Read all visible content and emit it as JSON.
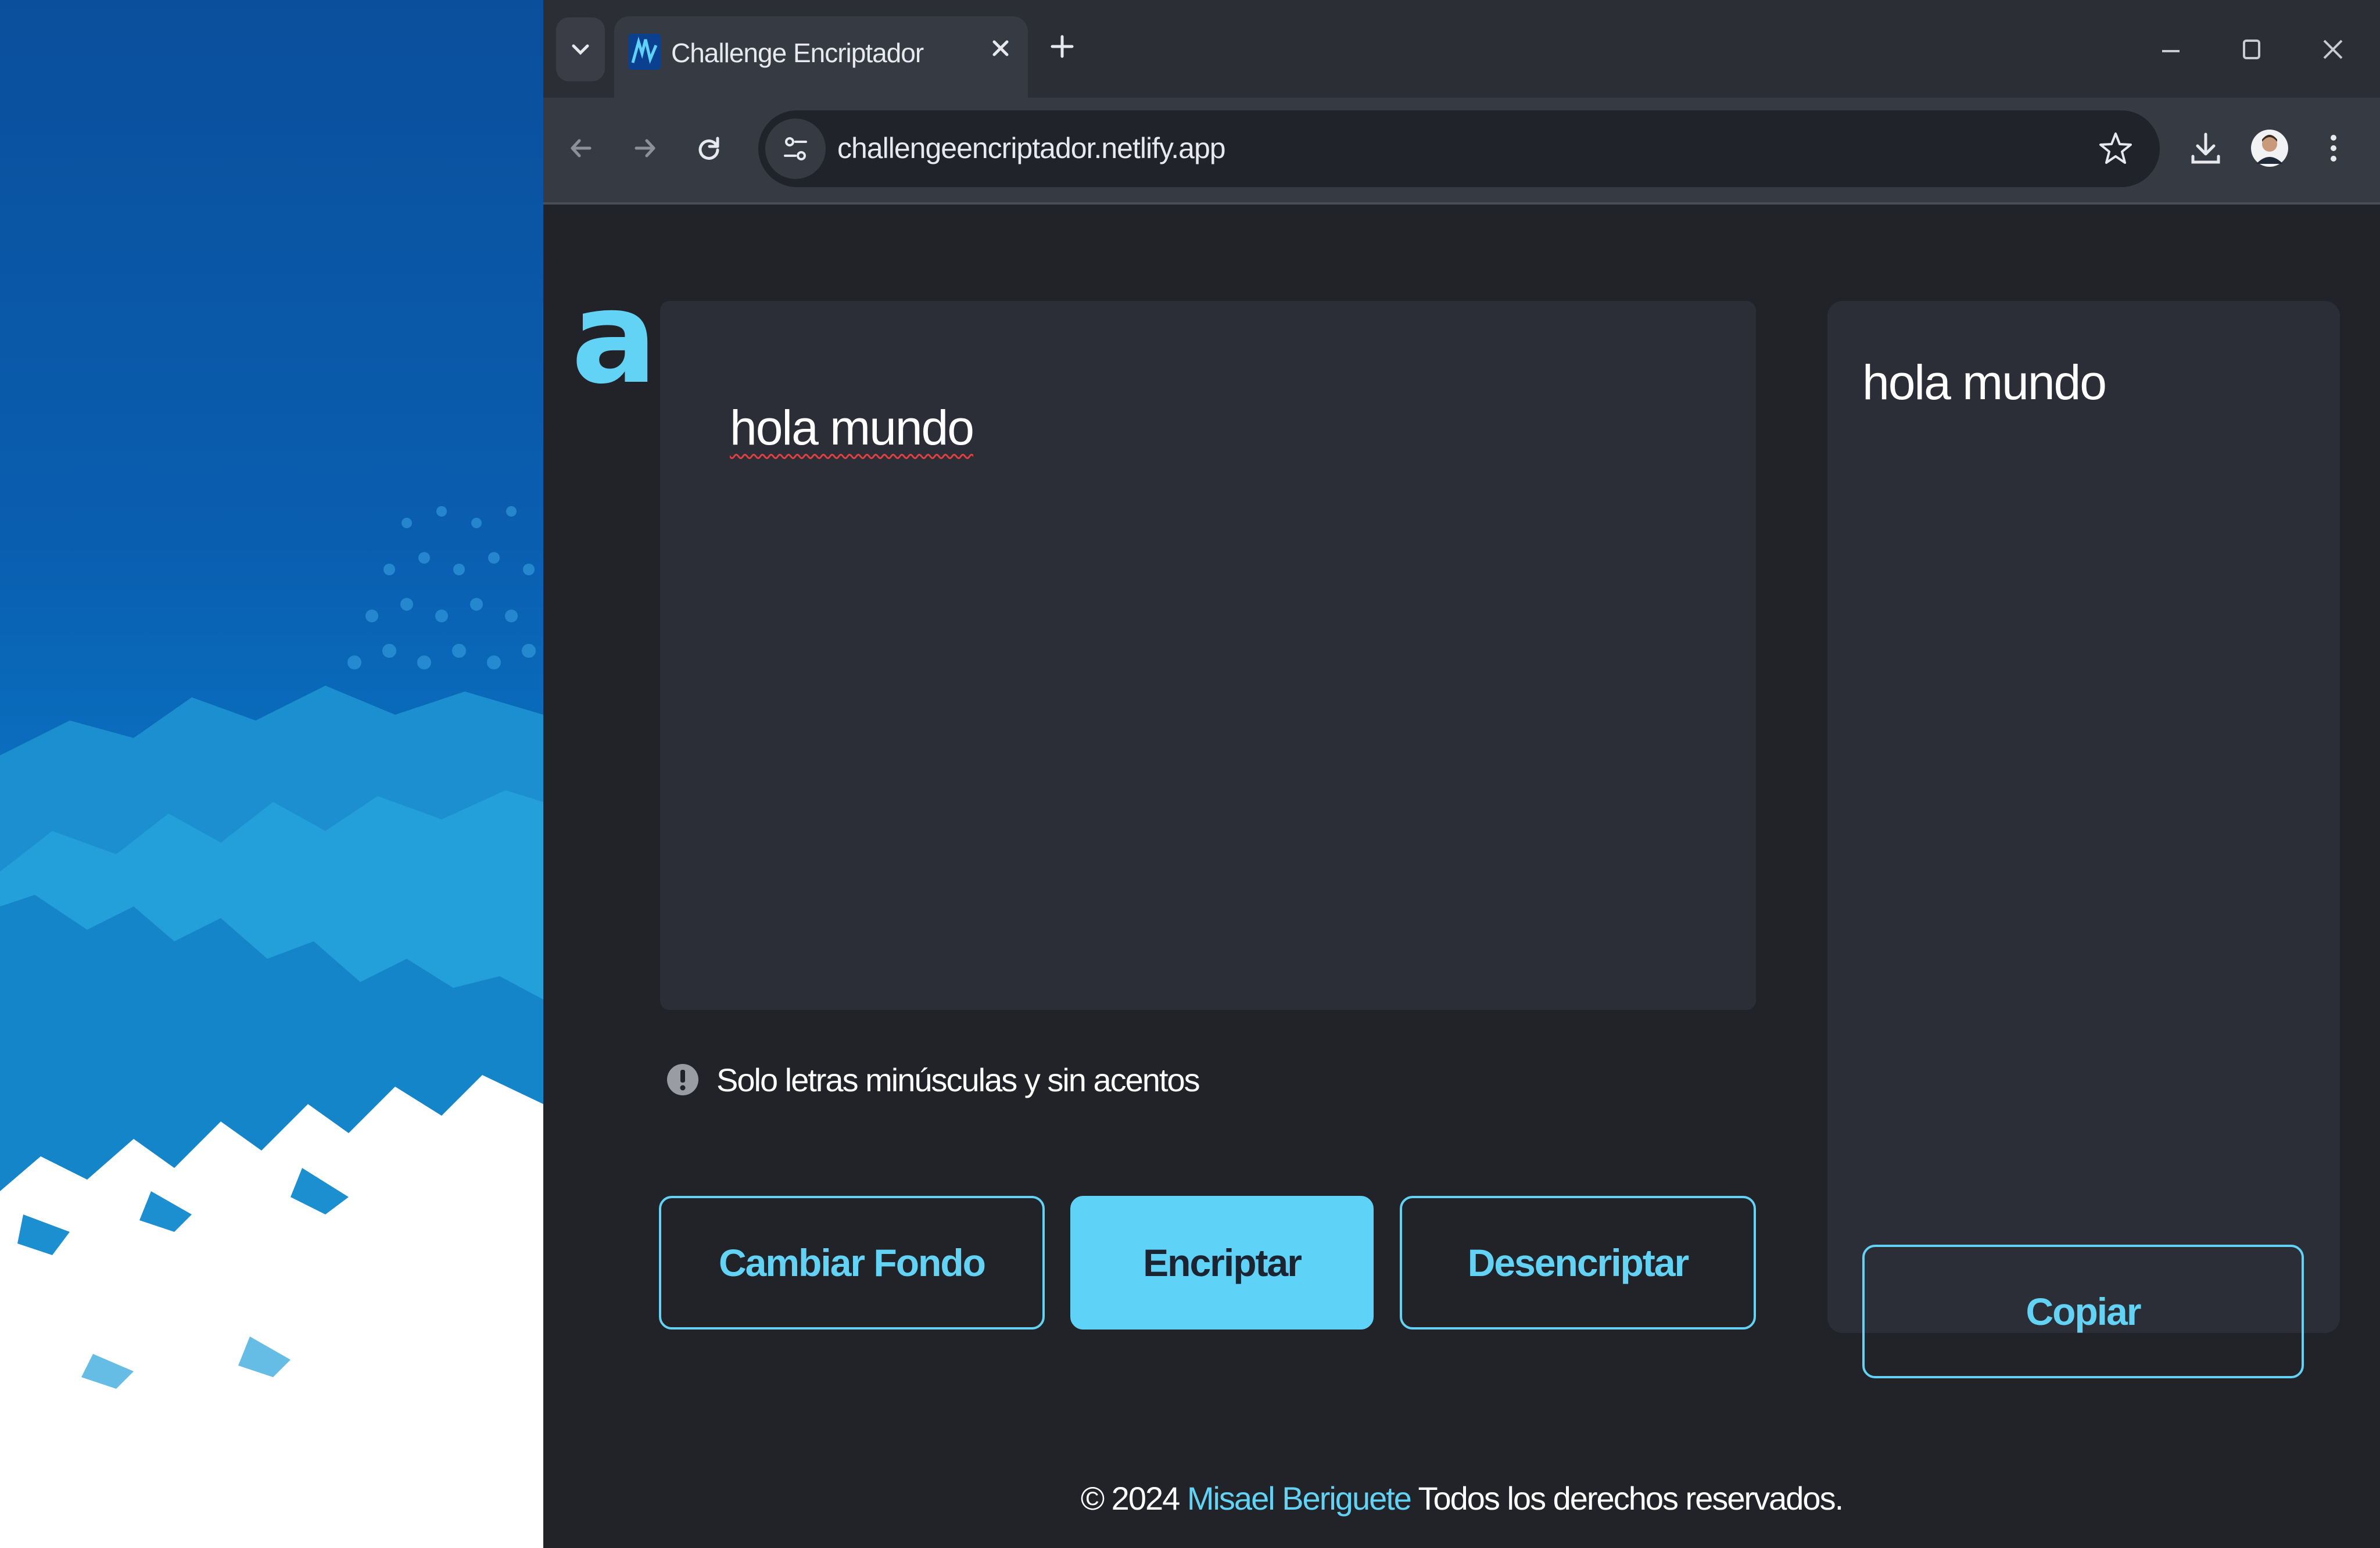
{
  "browser": {
    "tab": {
      "title": "Challenge Encriptador"
    },
    "url": "challengeencriptador.netlify.app"
  },
  "page": {
    "input_text": "hola mundo",
    "warning": "Solo letras minúsculas y sin acentos",
    "buttons": {
      "change_background": "Cambiar Fondo",
      "encrypt": "Encriptar",
      "decrypt": "Desencriptar"
    },
    "output_text": "hola mundo",
    "copy_label": "Copiar",
    "footer": {
      "copyright": "© 2024",
      "author": "Misael Beriguete",
      "rights": "Todos los derechos reservados."
    }
  },
  "colors": {
    "accent": "#62d2f5",
    "page_background": "#212329",
    "panel_background": "#2b2e36",
    "chrome_frame": "#2b2e35",
    "chrome_toolbar": "#363a42"
  },
  "icons": {
    "tab_search": "chevron-down-icon",
    "favicon": "site-favicon",
    "tab_close": "close-icon",
    "new_tab": "plus-icon",
    "back": "arrow-left-icon",
    "forward": "arrow-right-icon",
    "reload": "reload-icon",
    "site_info": "tune-icon",
    "bookmark": "star-icon",
    "download": "download-icon",
    "profile": "avatar",
    "menu": "kebab-menu-icon",
    "warning": "exclamation-circle-icon",
    "logo": "alura-logo"
  }
}
